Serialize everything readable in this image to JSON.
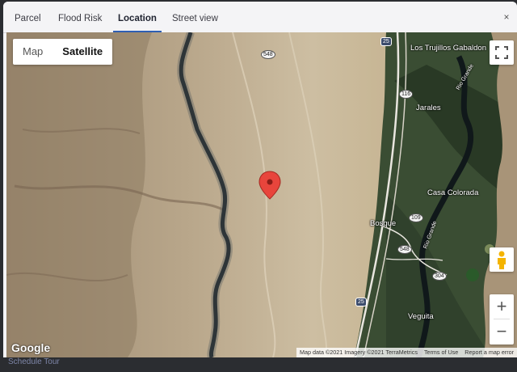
{
  "tabs": [
    {
      "label": "Parcel",
      "active": false
    },
    {
      "label": "Flood Risk",
      "active": false
    },
    {
      "label": "Location",
      "active": true
    },
    {
      "label": "Street view",
      "active": false
    }
  ],
  "close_icon": "×",
  "map": {
    "type_buttons": [
      {
        "label": "Map",
        "selected": false
      },
      {
        "label": "Satellite",
        "selected": true
      }
    ],
    "places": [
      "Los Trujillos Gabaldon",
      "Rio Grande",
      "Jarales",
      "Casa Colorada",
      "Bosque",
      "Rio Grande",
      "Veguita"
    ],
    "shields": [
      "548",
      "116",
      "109",
      "548",
      "304",
      "25",
      "25"
    ],
    "zoom_in": "+",
    "zoom_out": "−",
    "logo": "Google",
    "attribution": [
      "Map data ©2021 Imagery ©2021 TerraMetrics",
      "Terms of Use",
      "Report a map error"
    ],
    "marker_color": "#e8453c"
  },
  "below_text": "Schedule Tour"
}
